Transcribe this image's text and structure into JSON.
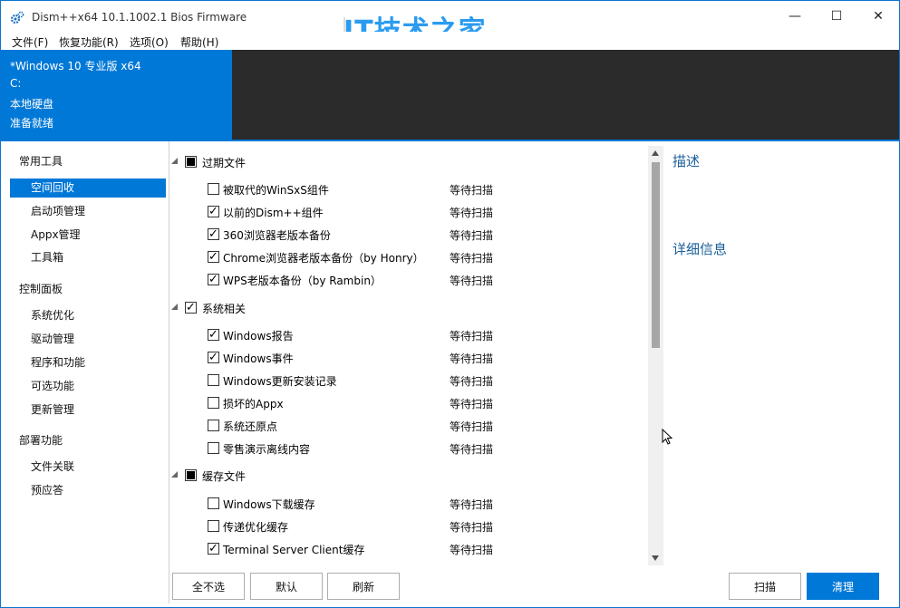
{
  "window": {
    "title": "Dism++x64 10.1.1002.1 Bios Firmware",
    "watermark": "IT技术之家",
    "controls": {
      "minimize": "—",
      "maximize": "☐",
      "close": "✕"
    }
  },
  "menu": [
    "文件(F)",
    "恢复功能(R)",
    "选项(O)",
    "帮助(H)"
  ],
  "sysinfo": {
    "os": "*Windows 10 专业版 x64",
    "drive": "C:",
    "disk_type": "本地硬盘",
    "status": "准备就绪"
  },
  "sidebar": {
    "categories": [
      {
        "label": "常用工具",
        "items": [
          "空间回收",
          "启动项管理",
          "Appx管理",
          "工具箱"
        ]
      },
      {
        "label": "控制面板",
        "items": [
          "系统优化",
          "驱动管理",
          "程序和功能",
          "可选功能",
          "更新管理"
        ]
      },
      {
        "label": "部署功能",
        "items": [
          "文件关联",
          "预应答"
        ]
      }
    ],
    "active": "空间回收"
  },
  "groups": [
    {
      "label": "过期文件",
      "state": "partial",
      "items": [
        {
          "label": "被取代的WinSxS组件",
          "checked": false,
          "status": "等待扫描"
        },
        {
          "label": "以前的Dism++组件",
          "checked": true,
          "status": "等待扫描"
        },
        {
          "label": "360浏览器老版本备份",
          "checked": true,
          "status": "等待扫描"
        },
        {
          "label": "Chrome浏览器老版本备份（by Honry）",
          "checked": true,
          "status": "等待扫描"
        },
        {
          "label": "WPS老版本备份（by Rambin）",
          "checked": true,
          "status": "等待扫描"
        }
      ]
    },
    {
      "label": "系统相关",
      "state": "checked",
      "items": [
        {
          "label": "Windows报告",
          "checked": true,
          "status": "等待扫描"
        },
        {
          "label": "Windows事件",
          "checked": true,
          "status": "等待扫描"
        },
        {
          "label": "Windows更新安装记录",
          "checked": false,
          "status": "等待扫描"
        },
        {
          "label": "损坏的Appx",
          "checked": false,
          "status": "等待扫描"
        },
        {
          "label": "系统还原点",
          "checked": false,
          "status": "等待扫描"
        },
        {
          "label": "零售演示离线内容",
          "checked": false,
          "status": "等待扫描"
        }
      ]
    },
    {
      "label": "缓存文件",
      "state": "partial",
      "items": [
        {
          "label": "Windows下载缓存",
          "checked": false,
          "status": "等待扫描"
        },
        {
          "label": "传递优化缓存",
          "checked": false,
          "status": "等待扫描"
        },
        {
          "label": "Terminal Server Client缓存",
          "checked": true,
          "status": "等待扫描"
        }
      ]
    }
  ],
  "right_pane": {
    "description_title": "描述",
    "details_title": "详细信息"
  },
  "buttons": {
    "deselect_all": "全不选",
    "default": "默认",
    "refresh": "刷新",
    "scan": "扫描",
    "clean": "清理"
  },
  "colors": {
    "accent": "#0078d7",
    "header_dark": "#2b2b2b",
    "section_title": "#1a5e9a"
  }
}
